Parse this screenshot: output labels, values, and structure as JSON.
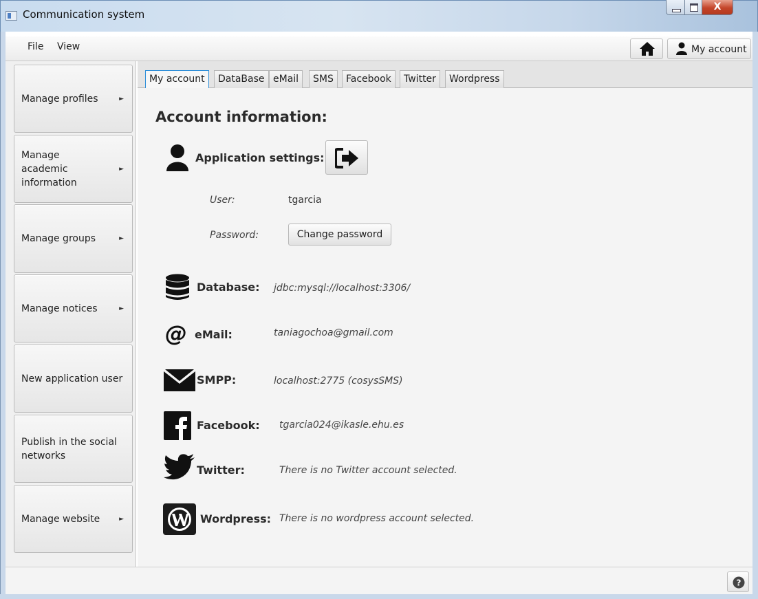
{
  "window": {
    "title": "Communication system",
    "close_label": "X"
  },
  "menubar": {
    "file": "File",
    "view": "View",
    "account_button": "My account"
  },
  "sidebar": {
    "items": [
      {
        "label": "Manage profiles",
        "arrow": "►"
      },
      {
        "label": "Manage academic information",
        "arrow": "►"
      },
      {
        "label": "Manage groups",
        "arrow": "►"
      },
      {
        "label": "Manage notices",
        "arrow": "►"
      },
      {
        "label": "New application user",
        "arrow": ""
      },
      {
        "label": "Publish in the social networks",
        "arrow": ""
      },
      {
        "label": "Manage website",
        "arrow": "►"
      }
    ]
  },
  "tabs": [
    "My account",
    "DataBase",
    "eMail",
    "SMS",
    "Facebook",
    "Twitter",
    "Wordpress"
  ],
  "active_tab": "My account",
  "account": {
    "title": "Account information:",
    "app_settings_label": "Application settings:",
    "user_label": "User:",
    "user_value": "tgarcia",
    "password_label": "Password:",
    "change_password_button": "Change password",
    "database_label": "Database:",
    "database_value": "jdbc:mysql://localhost:3306/",
    "email_label": "eMail:",
    "email_value": "taniagochoa@gmail.com",
    "smpp_label": "SMPP:",
    "smpp_value": "localhost:2775  (cosysSMS)",
    "facebook_label": "Facebook:",
    "facebook_value": "tgarcia024@ikasle.ehu.es",
    "twitter_label": "Twitter:",
    "twitter_value": "There is no Twitter account selected.",
    "wordpress_label": "Wordpress:",
    "wordpress_value": "There is no wordpress account selected."
  },
  "icons": [
    "app-icon",
    "home-icon",
    "user-icon",
    "logout-icon",
    "database-icon",
    "at-sign-icon",
    "envelope-icon",
    "facebook-icon",
    "twitter-icon",
    "wordpress-icon",
    "help-icon"
  ],
  "colors": {
    "active_tab_border": "#2e8fd9",
    "close_button": "#c4452a"
  }
}
